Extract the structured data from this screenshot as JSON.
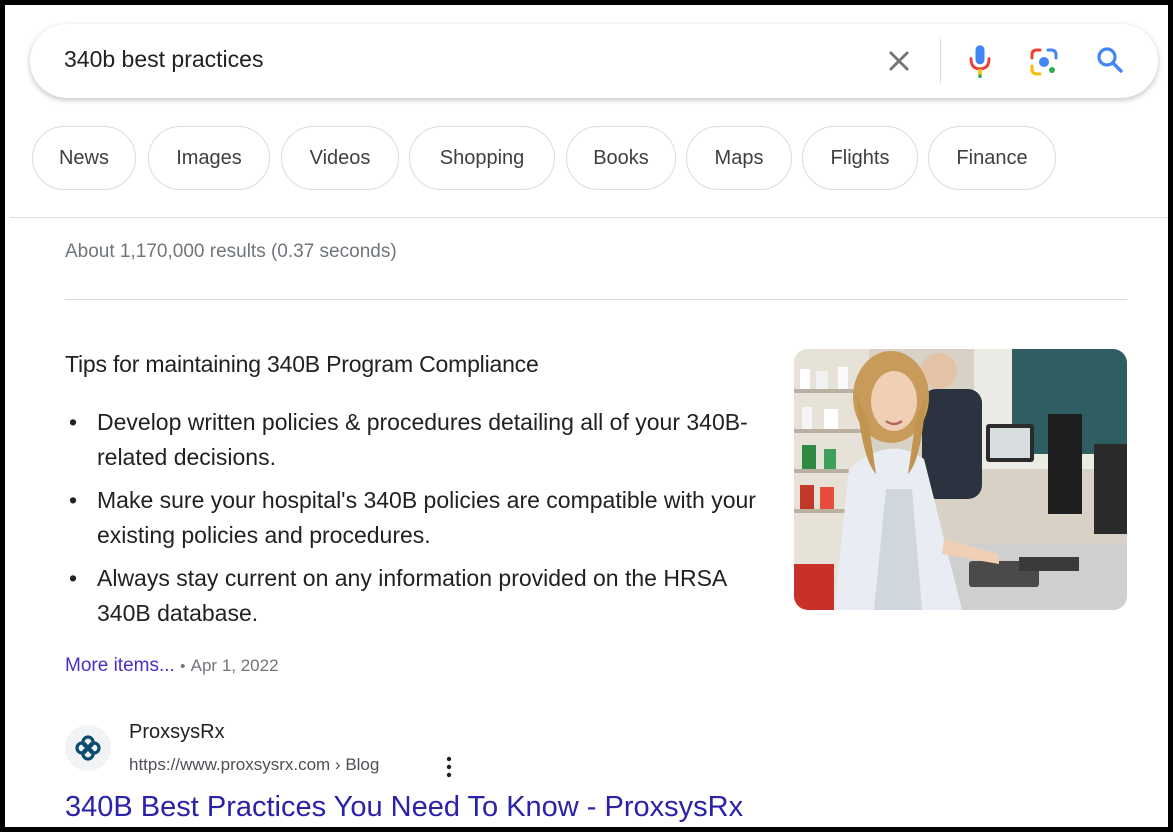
{
  "search": {
    "query": "340b best practices"
  },
  "chips": [
    {
      "label": "News"
    },
    {
      "label": "Images"
    },
    {
      "label": "Videos"
    },
    {
      "label": "Shopping"
    },
    {
      "label": "Books"
    },
    {
      "label": "Maps"
    },
    {
      "label": "Flights"
    },
    {
      "label": "Finance"
    }
  ],
  "results_stats": "About 1,170,000 results (0.37 seconds)",
  "featured_snippet": {
    "title": "Tips for maintaining 340B Program Compliance",
    "bullets": [
      "Develop written policies & procedures detailing all of your 340B-related decisions.",
      "Make sure your hospital's 340B policies are compatible with your existing policies and procedures.",
      "Always stay current on any information provided on the HRSA 340B database."
    ],
    "more_items_label": "More items...",
    "separator": "•",
    "date": "Apr 1, 2022"
  },
  "source": {
    "name": "ProxsysRx",
    "url": "https://www.proxsysrx.com › Blog",
    "result_title": "340B Best Practices You Need To Know - ProxsysRx"
  },
  "colors": {
    "link_blue": "#2a22a8",
    "more_link": "#4b2ec5",
    "google_blue": "#4285f4",
    "google_red": "#ea4335",
    "google_yellow": "#fbbc04",
    "google_green": "#34a853"
  }
}
